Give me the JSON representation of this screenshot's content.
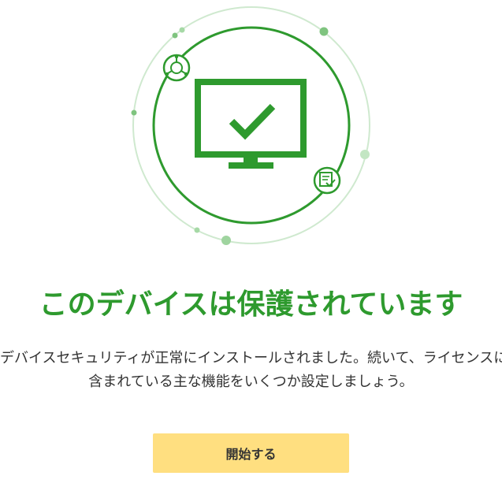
{
  "illustration": {
    "main_icon": "monitor-check-icon",
    "badge_icons": [
      "network-icon",
      "browser-check-icon"
    ],
    "colors": {
      "primary_green": "#2e9a2e",
      "light_green": "#c8e6c8",
      "dot_green": "#9fd49f"
    }
  },
  "main": {
    "title": "このデバイスは保護されています",
    "description_line1": "デバイスセキュリティが正常にインストールされました。続いて、ライセンスに",
    "description_line2": "含まれている主な機能をいくつか設定しましょう。"
  },
  "actions": {
    "start_label": "開始する",
    "button_color": "#ffdf80"
  }
}
